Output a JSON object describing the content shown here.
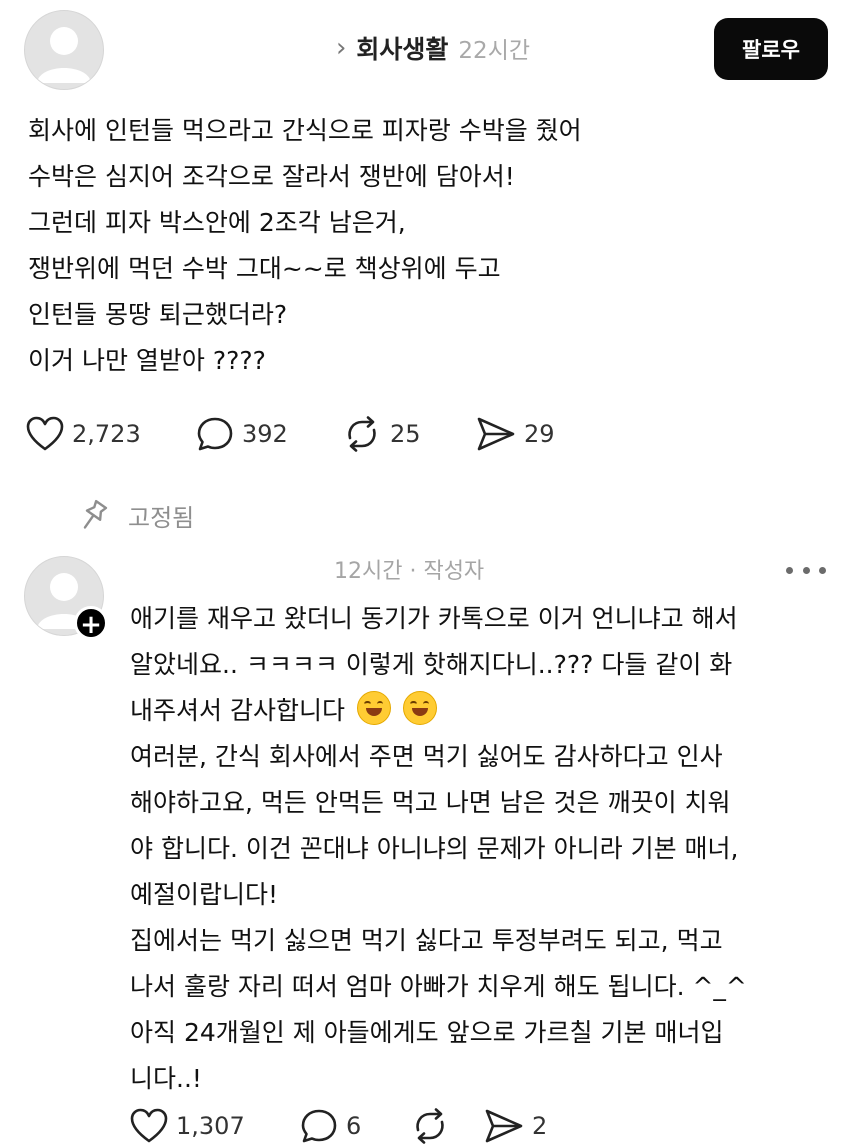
{
  "post": {
    "community_name": "회사생활",
    "chevron": "›",
    "time": "22시간",
    "follow_label": "팔로우",
    "body_lines": [
      "회사에 인턴들 먹으라고 간식으로 피자랑 수박을 줬어",
      "수박은 심지어 조각으로 잘라서 쟁반에 담아서!",
      "그런데 피자 박스안에 2조각 남은거,",
      "쟁반위에 먹던 수박 그대~~로 책상위에 두고",
      "인턴들 몽땅 퇴근했더라?",
      "이거 나만 열받아 ????"
    ],
    "likes": "2,723",
    "comments": "392",
    "reposts": "25",
    "shares": "29"
  },
  "pinned": {
    "label": "고정됨"
  },
  "reply": {
    "meta": "12시간 · 작성자",
    "badge": "+",
    "body_lines": [
      "애기를 재우고 왔더니 동기가 카톡으로 이거 언니냐고 해서",
      "알았네요.. ㅋㅋㅋㅋ 이렇게 핫해지다니..??? 다들 같이 화",
      "내주셔서 감사합니다",
      "여러분, 간식 회사에서 주면 먹기 싫어도 감사하다고 인사",
      "해야하고요, 먹든 안먹든 먹고 나면 남은 것은 깨끗이 치워",
      "야 합니다. 이건 꼰대냐 아니냐의 문제가 아니라 기본 매너,",
      "예절이랍니다!",
      "집에서는 먹기 싫으면 먹기 싫다고 투정부려도 되고, 먹고",
      "나서 훌랑 자리 떠서 엄마 아빠가 치우게 해도 됩니다. ^_^",
      "아직 24개월인 제 아들에게도 앞으로 가르칠 기본 매너입",
      "니다..!"
    ],
    "emoji_icons": [
      "smiling-face-emoji",
      "smiling-face-emoji"
    ],
    "likes": "1,307",
    "comments": "6",
    "shares": "2"
  },
  "icons": {
    "like": "heart-icon",
    "comment": "speech-bubble-icon",
    "repost": "repost-icon",
    "share": "send-icon",
    "pin": "pin-icon",
    "more": "more-icon"
  }
}
